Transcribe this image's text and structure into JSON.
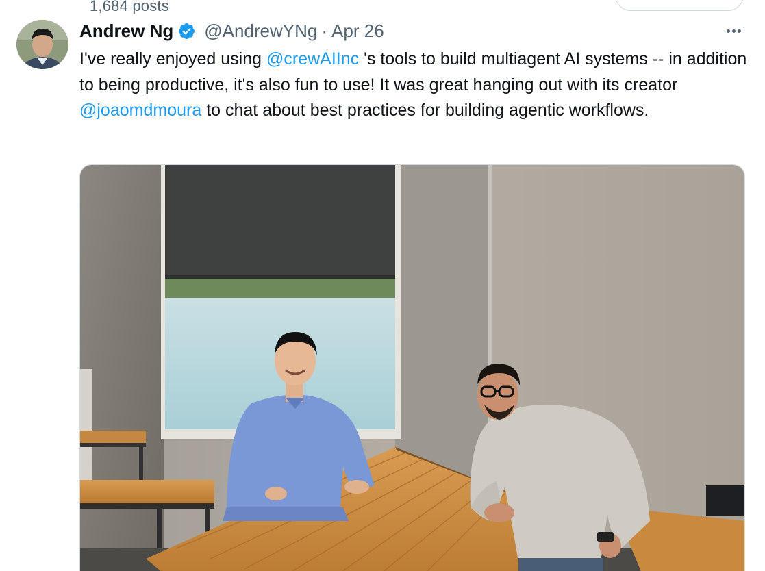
{
  "profile_header": {
    "post_count": "1,684 posts"
  },
  "tweet": {
    "author_name": "Andrew Ng",
    "handle": "@AndrewYNg",
    "separator": "·",
    "date": "Apr 26",
    "text_parts": {
      "p1": "I've really enjoyed using ",
      "mention1": "@crewAIInc",
      "p2": " 's tools to build multiagent AI systems -- in addition to being productive, it's also fun to use! It was great hanging out with its creator ",
      "mention2": "@joaomdmoura",
      "p3": " to chat about best practices for building agentic workflows."
    }
  },
  "icons": {
    "verified": "verified-badge-icon",
    "more": "more-options-icon"
  },
  "colors": {
    "link": "#1d9bf0",
    "secondary_text": "#536471",
    "verified": "#1d9bf0"
  }
}
